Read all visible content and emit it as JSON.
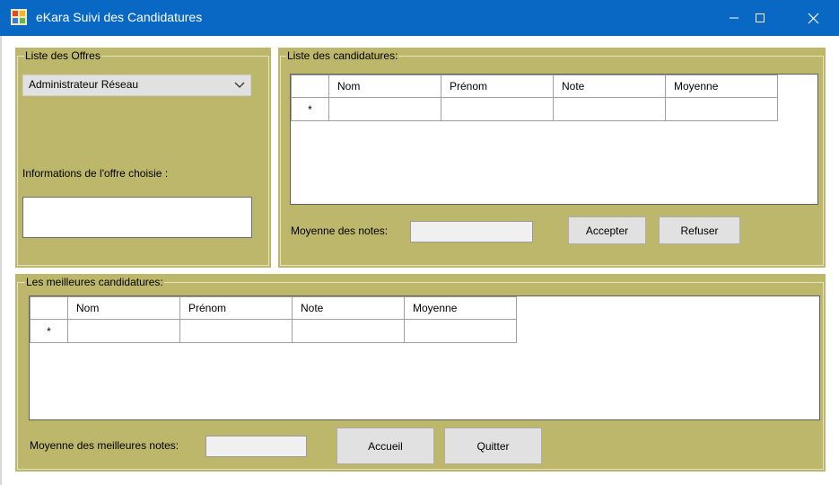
{
  "window": {
    "title": "eKara Suivi des Candidatures",
    "colors": {
      "titlebar": "#0868c4",
      "panel": "#bdb76b"
    },
    "controls": [
      "minimize-icon",
      "maximize-icon",
      "close-icon"
    ]
  },
  "offres": {
    "legend": "Liste des Offres",
    "selected": "Administrateur Réseau",
    "info_label": "Informations de l'offre choisie :",
    "info_value": ""
  },
  "candidatures": {
    "legend": "Liste des candidatures:",
    "columns": [
      "Nom",
      "Prénom",
      "Note",
      "Moyenne"
    ],
    "new_row_marker": "*",
    "moyenne_label": "Moyenne des notes:",
    "moyenne_value": "",
    "accept_label": "Accepter",
    "refuse_label": "Refuser"
  },
  "meilleures": {
    "legend": "Les meilleures candidatures:",
    "columns": [
      "Nom",
      "Prénom",
      "Note",
      "Moyenne"
    ],
    "new_row_marker": "*",
    "moyenne_label": "Moyenne des meilleures notes:",
    "moyenne_value": "",
    "accueil_label": "Accueil",
    "quitter_label": "Quitter"
  }
}
